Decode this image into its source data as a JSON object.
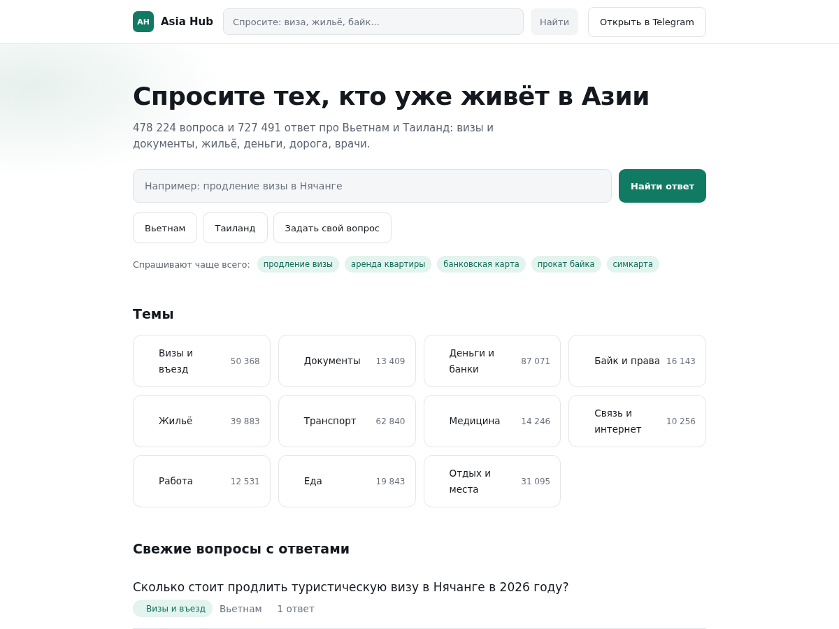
{
  "header": {
    "logo_mark": "AH",
    "brand": "Asia Hub",
    "search": {
      "placeholder": "Спросите: виза, жильё, байк..."
    },
    "search_button": "Найти",
    "telegram_button": "Открыть в Telegram"
  },
  "hero": {
    "title": "Спросите тех, кто уже живёт в Азии",
    "subtitle": "478 224 вопроса и 727 491 ответ про Вьетнам и Таиланд: визы и документы, жильё, деньги, дорога, врачи.",
    "search": {
      "placeholder": "Например: продление визы в Нячанге"
    },
    "search_button": "Найти ответ",
    "filters": [
      "Вьетнам",
      "Таиланд",
      "Задать свой вопрос"
    ],
    "popular_label": "Спрашивают чаще всего:",
    "popular_tags": [
      "продление визы",
      "аренда квартиры",
      "банковская карта",
      "прокат байка",
      "симкарта"
    ]
  },
  "topics": {
    "title": "Темы",
    "items": [
      {
        "name": "Визы и въезд",
        "count": "50 368"
      },
      {
        "name": "Документы",
        "count": "13 409"
      },
      {
        "name": "Деньги и банки",
        "count": "87 071"
      },
      {
        "name": "Байк и права",
        "count": "16 143"
      },
      {
        "name": "Жильё",
        "count": "39 883"
      },
      {
        "name": "Транспорт",
        "count": "62 840"
      },
      {
        "name": "Медицина",
        "count": "14 246"
      },
      {
        "name": "Связь и интернет",
        "count": "10 256"
      },
      {
        "name": "Работа",
        "count": "12 531"
      },
      {
        "name": "Еда",
        "count": "19 843"
      },
      {
        "name": "Отдых и места",
        "count": "31 095"
      }
    ]
  },
  "recent": {
    "title": "Свежие вопросы с ответами",
    "questions": [
      {
        "title": "Сколько стоит продлить туристическую визу в Нячанге в 2026 году?",
        "topic": "Визы и въезд",
        "country": "Вьетнам",
        "answers": "1 ответ"
      }
    ]
  }
}
